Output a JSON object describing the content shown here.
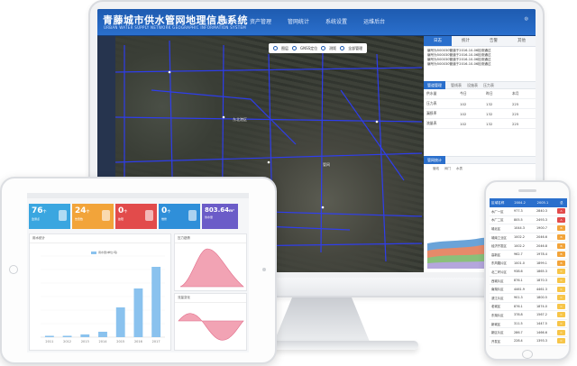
{
  "monitor": {
    "title": "青藤城市供水管网地理信息系统",
    "subtitle": "URBAN WATER SUPPLY NETWORK GEOGRAPHIC INFORMATION SYSTEM",
    "nav": [
      "首页",
      "资产管理",
      "管网统计",
      "系统设置",
      "运维后台"
    ],
    "map_tools": [
      "图层",
      "GNSS定位",
      "测距",
      "全部管理"
    ],
    "map_labels": [
      "东北港区",
      "管网",
      "清河路"
    ],
    "side_tabs": [
      "日志",
      "统计",
      "告警",
      "其他"
    ],
    "log_lines": [
      "编号为500030管道于2016-10-06检测通过",
      "编号为500030管道于2016-10-06检测通过",
      "编号为500030管道于2016-10-06检测通过",
      "编号为500030管道于2016-10-06检测通过"
    ],
    "sec1_tabs": [
      "管道管理",
      "管线表",
      "设施表",
      "压力表"
    ],
    "table_rows": [
      [
        "供水量",
        "今日",
        "昨日",
        "本月"
      ],
      [
        "压力表",
        "102",
        "132",
        "225"
      ],
      [
        "漏损率",
        "102",
        "132",
        "225"
      ],
      [
        "流量表",
        "102",
        "132",
        "225"
      ]
    ],
    "sec2_title": "管网统计",
    "sec2_legend": [
      "管线",
      "阀门",
      "水表"
    ]
  },
  "tablet": {
    "cards": [
      {
        "value": "76",
        "unit": "个",
        "label": "监测点",
        "color": "#3aa6e0"
      },
      {
        "value": "24",
        "unit": "个",
        "label": "告警数",
        "color": "#f2a43a"
      },
      {
        "value": "0",
        "unit": "个",
        "label": "故障",
        "color": "#e24b4b"
      },
      {
        "value": "0",
        "unit": "个",
        "label": "维修",
        "color": "#2f8fd9"
      },
      {
        "value": "803.64",
        "unit": "m³",
        "label": "供水量",
        "color": "#6b5cc8"
      }
    ],
    "panel_left_title": "用水统计",
    "panel_right_title": "压力趋势",
    "panel_right2_title": "流量变化",
    "bar_legend": "用水量(单位:吨)"
  },
  "chart_data": {
    "type": "bar",
    "categories": [
      "2011",
      "2012",
      "2013",
      "2014",
      "2015",
      "2016",
      "2017"
    ],
    "values": [
      1,
      1,
      2,
      4,
      22,
      36,
      52
    ],
    "ylim": [
      0,
      60
    ]
  },
  "phone": {
    "head": [
      "区域名称",
      "2004.2",
      "2005.1",
      "总"
    ],
    "rows": [
      [
        "水厂一区",
        "977.3",
        "2840.3",
        "A",
        "#e24b4b"
      ],
      [
        "水厂二区",
        "805.5",
        "2493.3",
        "A",
        "#e24b4b"
      ],
      [
        "城北区",
        "1044.3",
        "1900.7",
        "B",
        "#f2a43a"
      ],
      [
        "城南工业区",
        "1002.2",
        "2046.6",
        "B",
        "#f2a43a"
      ],
      [
        "经济开发区",
        "1002.2",
        "2046.8",
        "B",
        "#f2a43a"
      ],
      [
        "高新区",
        "962.7",
        "1978.4",
        "B",
        "#f2a43a"
      ],
      [
        "东风路片区",
        "1001.0",
        "1899.1",
        "B",
        "#f2a43a"
      ],
      [
        "北二环片区",
        "938.6",
        "1865.3",
        "C",
        "#f7c548"
      ],
      [
        "西城片区",
        "876.1",
        "1870.3",
        "C",
        "#f7c548"
      ],
      [
        "南湖片区",
        "4461.9",
        "4461.3",
        "C",
        "#f7c548"
      ],
      [
        "滨江片区",
        "901.3",
        "1800.5",
        "C",
        "#f7c548"
      ],
      [
        "老城区",
        "876.1",
        "1874.0",
        "C",
        "#f7c548"
      ],
      [
        "东湖片区",
        "378.8",
        "1567.2",
        "C",
        "#f7c548"
      ],
      [
        "新城区",
        "311.5",
        "1447.5",
        "C",
        "#f7c548"
      ],
      [
        "新区片区",
        "286.7",
        "1466.6",
        "C",
        "#f7c548"
      ],
      [
        "开发区",
        "228.4",
        "1393.3",
        "C",
        "#f7c548"
      ],
      [
        "乡镇管网",
        "426.4",
        "1456.8",
        "C",
        "#f7c548"
      ],
      [
        "工业园区",
        "442.7",
        "1397.7",
        "C",
        "#f7c548"
      ]
    ]
  }
}
